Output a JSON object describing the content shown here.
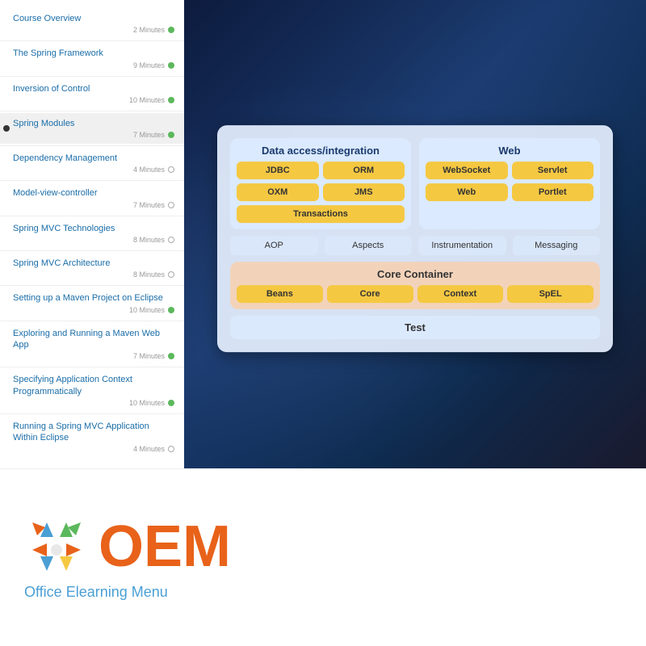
{
  "sidebar": {
    "items": [
      {
        "id": "course-overview",
        "title": "Course Overview",
        "duration": "2 Minutes",
        "status": "green"
      },
      {
        "id": "spring-framework",
        "title": "The Spring Framework",
        "duration": "9 Minutes",
        "status": "green"
      },
      {
        "id": "inversion-of-control",
        "title": "Inversion of Control",
        "duration": "10 Minutes",
        "status": "green"
      },
      {
        "id": "spring-modules",
        "title": "Spring Modules",
        "duration": "7 Minutes",
        "status": "green",
        "active": true
      },
      {
        "id": "dependency-management",
        "title": "Dependency Management",
        "duration": "4 Minutes",
        "status": "gray-ring"
      },
      {
        "id": "model-view-controller",
        "title": "Model-view-controller",
        "duration": "7 Minutes",
        "status": "gray-ring"
      },
      {
        "id": "spring-mvc-technologies",
        "title": "Spring MVC Technologies",
        "duration": "8 Minutes",
        "status": "gray-ring"
      },
      {
        "id": "spring-mvc-architecture",
        "title": "Spring MVC Architecture",
        "duration": "8 Minutes",
        "status": "gray-ring"
      },
      {
        "id": "maven-project-eclipse",
        "title": "Setting up a Maven Project on Eclipse",
        "duration": "10 Minutes",
        "status": "green"
      },
      {
        "id": "exploring-maven-webapp",
        "title": "Exploring and Running a Maven Web App",
        "duration": "7 Minutes",
        "status": "green"
      },
      {
        "id": "specifying-app-context",
        "title": "Specifying Application Context Programmatically",
        "duration": "10 Minutes",
        "status": "green"
      },
      {
        "id": "running-spring-mvc",
        "title": "Running a Spring MVC Application Within Eclipse",
        "duration": "4 Minutes",
        "status": "gray-ring"
      }
    ]
  },
  "diagram": {
    "data_access_title": "Data access/integration",
    "jdbc_label": "JDBC",
    "orm_label": "ORM",
    "oxm_label": "OXM",
    "jms_label": "JMS",
    "transactions_label": "Transactions",
    "web_title": "Web",
    "websocket_label": "WebSocket",
    "servlet_label": "Servlet",
    "web_label": "Web",
    "portlet_label": "Portlet",
    "aop_label": "AOP",
    "aspects_label": "Aspects",
    "instrumentation_label": "Instrumentation",
    "messaging_label": "Messaging",
    "core_container_title": "Core Container",
    "beans_label": "Beans",
    "core_label": "Core",
    "context_label": "Context",
    "spel_label": "SpEL",
    "test_label": "Test"
  },
  "oem": {
    "text": "OEM",
    "subtitle": "Office Elearning Menu",
    "arrows": [
      "↗",
      "↑",
      "↖",
      "→",
      "",
      "←",
      "↘",
      "↓",
      "↙"
    ],
    "arrow_colors": [
      "#e8621a",
      "#4a9fd4",
      "#5cb85c",
      "#e8621a",
      "",
      "#f5c842",
      "#4a9fd4",
      "#e8621a",
      "#5cb85c"
    ]
  }
}
